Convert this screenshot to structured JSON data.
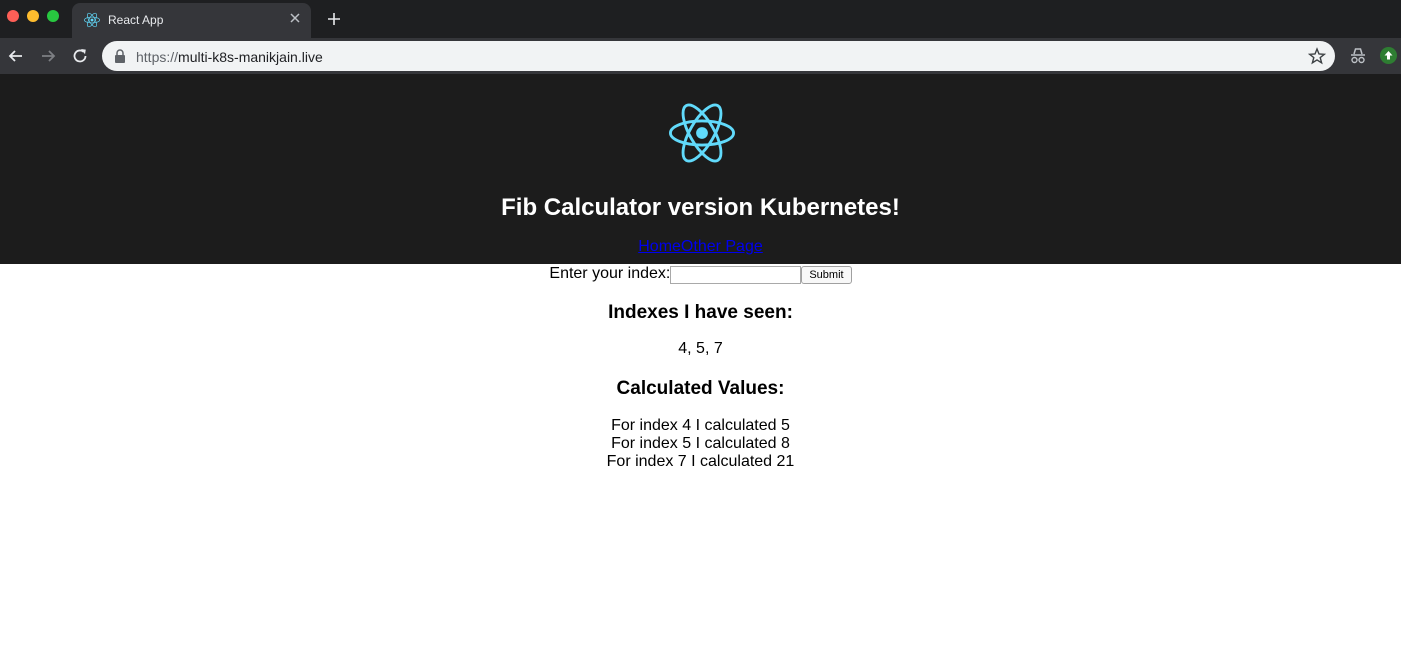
{
  "browser": {
    "tab_title": "React App",
    "url_scheme": "https://",
    "url_host": "multi-k8s-manikjain.live"
  },
  "app": {
    "title": "Fib Calculator version Kubernetes!",
    "nav": {
      "home": "Home",
      "other": "Other Page"
    },
    "form": {
      "label": "Enter your index:",
      "input_value": "",
      "submit_label": "Submit"
    },
    "seen_heading": "Indexes I have seen:",
    "seen_values": "4, 5, 7",
    "calc_heading": "Calculated Values:",
    "calculated": [
      "For index 4 I calculated 5",
      "For index 5 I calculated 8",
      "For index 7 I calculated 21"
    ]
  },
  "colors": {
    "header_bg": "#1c1c1c",
    "react_blue": "#61dafb",
    "link": "#0000ee"
  },
  "icons": [
    "react-icon",
    "close-icon",
    "plus-icon",
    "back-arrow-icon",
    "forward-arrow-icon",
    "reload-icon",
    "lock-icon",
    "star-icon",
    "incognito-icon",
    "extension-icon"
  ]
}
